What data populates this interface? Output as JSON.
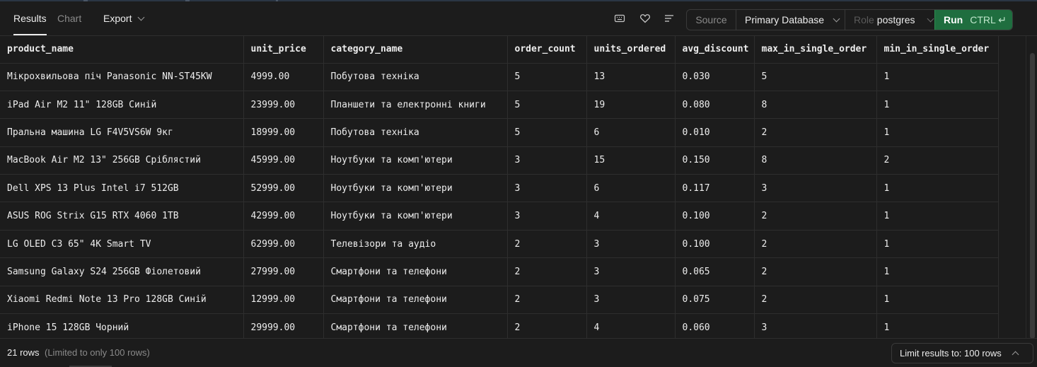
{
  "toolbar": {
    "tabs": [
      {
        "label": "Results",
        "active": true
      },
      {
        "label": "Chart",
        "active": false
      }
    ],
    "export_label": "Export",
    "icons": [
      "keyboard-icon",
      "heart-icon",
      "align-left-icon"
    ],
    "source_label": "Source",
    "database": "Primary Database",
    "role_label": "Role",
    "role_value": "postgres",
    "run_label": "Run",
    "run_shortcut": "CTRL ↵",
    "run_color": "#1f6e3f"
  },
  "table": {
    "columns": [
      "product_name",
      "unit_price",
      "category_name",
      "order_count",
      "units_ordered",
      "avg_discount",
      "max_in_single_order",
      "min_in_single_order"
    ],
    "rows": [
      [
        "Мікрохвильова піч Panasonic NN-ST45KW",
        "4999.00",
        "Побутова техніка",
        "5",
        "13",
        "0.030",
        "5",
        "1"
      ],
      [
        "iPad Air M2 11\" 128GB Синій",
        "23999.00",
        "Планшети та електронні книги",
        "5",
        "19",
        "0.080",
        "8",
        "1"
      ],
      [
        "Пральна машина LG F4V5VS6W 9кг",
        "18999.00",
        "Побутова техніка",
        "5",
        "6",
        "0.010",
        "2",
        "1"
      ],
      [
        "MacBook Air M2 13\" 256GB Сріблястий",
        "45999.00",
        "Ноутбуки та комп'ютери",
        "3",
        "15",
        "0.150",
        "8",
        "2"
      ],
      [
        "Dell XPS 13 Plus Intel i7 512GB",
        "52999.00",
        "Ноутбуки та комп'ютери",
        "3",
        "6",
        "0.117",
        "3",
        "1"
      ],
      [
        "ASUS ROG Strix G15 RTX 4060 1TB",
        "42999.00",
        "Ноутбуки та комп'ютери",
        "3",
        "4",
        "0.100",
        "2",
        "1"
      ],
      [
        "LG OLED C3 65\" 4K Smart TV",
        "62999.00",
        "Телевізори та аудіо",
        "2",
        "3",
        "0.100",
        "2",
        "1"
      ],
      [
        "Samsung Galaxy S24 256GB Фіолетовий",
        "27999.00",
        "Смартфони та телефони",
        "2",
        "3",
        "0.065",
        "2",
        "1"
      ],
      [
        "Xiaomi Redmi Note 13 Pro 128GB Синій",
        "12999.00",
        "Смартфони та телефони",
        "2",
        "3",
        "0.075",
        "2",
        "1"
      ],
      [
        "iPhone 15 128GB Чорний",
        "29999.00",
        "Смартфони та телефони",
        "2",
        "4",
        "0.060",
        "3",
        "1"
      ]
    ]
  },
  "footer": {
    "rows_count": "21 rows",
    "rows_limit_note": "(Limited to only 100 rows)",
    "limit_button": "Limit results to: 100 rows"
  }
}
